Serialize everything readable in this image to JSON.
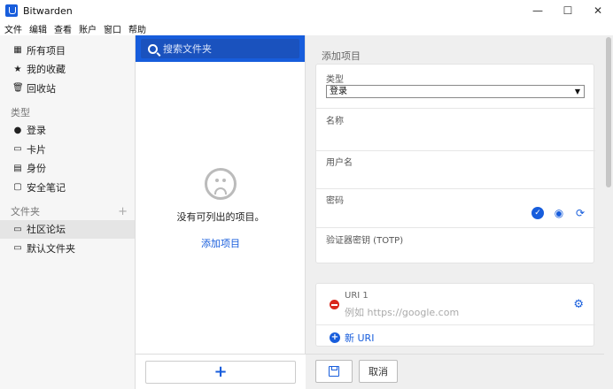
{
  "window": {
    "title": "Bitwarden",
    "minimize_glyph": "—",
    "maximize_glyph": "☐",
    "close_glyph": "✕"
  },
  "menu": [
    "文件",
    "编辑",
    "查看",
    "账户",
    "窗口",
    "帮助"
  ],
  "sidebar": {
    "top_items": [
      {
        "label": "所有项目",
        "icon": "grid-icon"
      },
      {
        "label": "我的收藏",
        "icon": "star-icon"
      },
      {
        "label": "回收站",
        "icon": "trash-icon"
      }
    ],
    "types_heading": "类型",
    "type_items": [
      {
        "label": "登录",
        "icon": "globe-icon"
      },
      {
        "label": "卡片",
        "icon": "credit-card-icon"
      },
      {
        "label": "身份",
        "icon": "id-card-icon"
      },
      {
        "label": "安全笔记",
        "icon": "note-icon"
      }
    ],
    "folders_heading": "文件夹",
    "folder_items": [
      {
        "label": "社区论坛",
        "icon": "folder-icon",
        "selected": true
      },
      {
        "label": "默认文件夹",
        "icon": "folder-icon",
        "selected": false
      }
    ]
  },
  "list": {
    "search_placeholder": "搜索文件夹",
    "empty_text": "没有可列出的项目。",
    "empty_link": "添加项目",
    "add_glyph": "+"
  },
  "detail": {
    "title": "添加项目",
    "type_label": "类型",
    "type_value": "登录",
    "name_label": "名称",
    "username_label": "用户名",
    "password_label": "密码",
    "totp_label": "验证器密钥 (TOTP)",
    "uri_label": "URI 1",
    "uri_placeholder": "例如 https://google.com",
    "new_uri_label": "新 URI",
    "cancel_label": "取消"
  },
  "colors": {
    "accent": "#175ddc",
    "danger": "#d9261c"
  }
}
